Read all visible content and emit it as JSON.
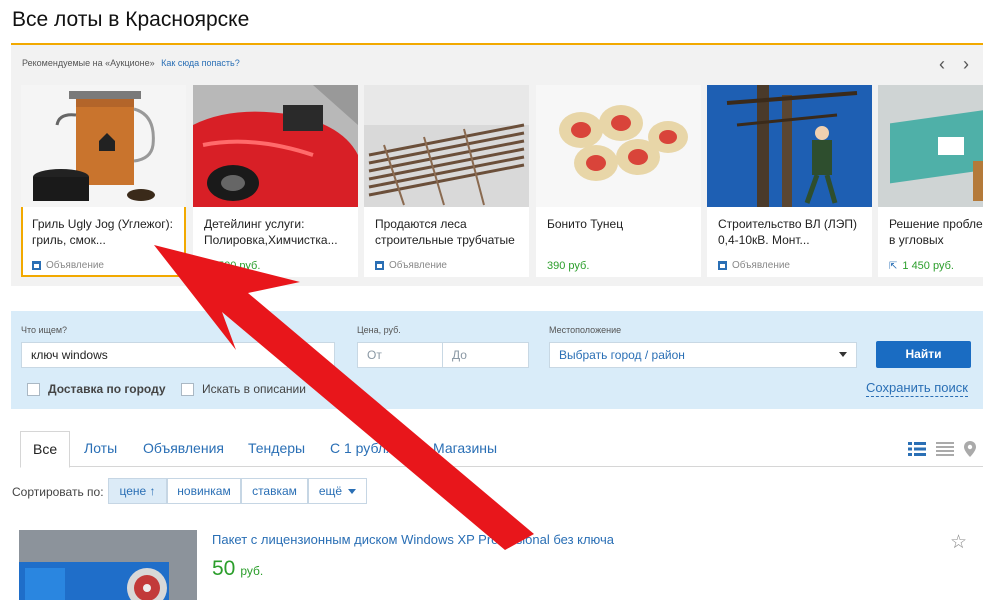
{
  "page": {
    "title": "Все лоты в Красноярске"
  },
  "promo": {
    "label": "Рекомендуемые на «Аукционе»",
    "link": "Как сюда попасть?",
    "prev": "‹",
    "next": "›",
    "cards": [
      {
        "title": "Гриль Ugly Jog (Углежог): гриль, смок...",
        "meta": "Объявление",
        "image": "orange-grill"
      },
      {
        "title": "Детейлинг услуги: Полировка,Химчистка...",
        "meta": "500 руб.",
        "image": "red-car"
      },
      {
        "title": "Продаются леса строительные трубчатые",
        "meta": "Объявление",
        "image": "scaffolding-pipes"
      },
      {
        "title": "Бонито Тунец",
        "meta": "390 руб.",
        "image": "sushi-rolls"
      },
      {
        "title": "Строительство ВЛ (ЛЭП) 0,4-10кВ. Монт...",
        "meta": "Объявление",
        "image": "power-line-worker"
      },
      {
        "title": "Решение пробле холода в угловых",
        "meta": "1 450 руб.",
        "image": "insulation-panel"
      }
    ]
  },
  "search": {
    "query_label": "Что ищем?",
    "query_value": "ключ windows",
    "price_label": "Цена, руб.",
    "price_from": "От",
    "price_to": "До",
    "location_label": "Местоположение",
    "location_value": "Выбрать город / район",
    "submit": "Найти",
    "delivery": "Доставка по городу",
    "in_description": "Искать в описании",
    "save": "Сохранить поиск"
  },
  "tabs": [
    "Все",
    "Лоты",
    "Объявления",
    "Тендеры",
    "С 1 рубля",
    "Магазины"
  ],
  "sort": {
    "label": "Сортировать по:",
    "options": [
      "цене ↑",
      "новинкам",
      "ставкам",
      "ещё"
    ]
  },
  "listing": {
    "title": "Пакет с лицензионным диском Windows XP Professional без ключа",
    "price": "50",
    "currency": "руб."
  },
  "colors": {
    "accent": "#f2a900",
    "link": "#2a6fb5",
    "price": "#2b9e2b",
    "button": "#1a6cc2",
    "overlay_arrow": "#e8161b"
  }
}
